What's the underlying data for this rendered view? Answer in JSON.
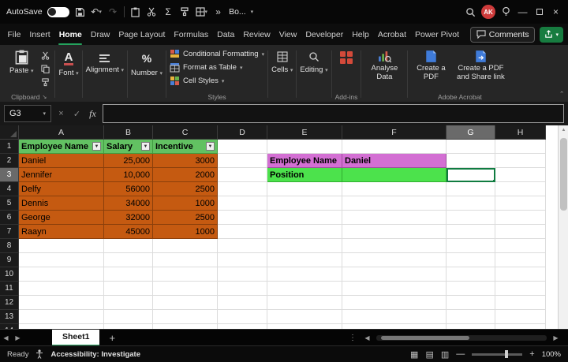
{
  "titlebar": {
    "autosave_label": "AutoSave",
    "workbook_label": "Bo...",
    "avatar_initials": "AK"
  },
  "ribbon": {
    "tabs": [
      "File",
      "Insert",
      "Home",
      "Draw",
      "Page Layout",
      "Formulas",
      "Data",
      "Review",
      "View",
      "Developer",
      "Help",
      "Acrobat",
      "Power Pivot"
    ],
    "active_tab": "Home",
    "comments_label": "Comments",
    "clipboard": {
      "group_label": "Clipboard",
      "paste_label": "Paste"
    },
    "font_label": "Font",
    "alignment_label": "Alignment",
    "number_label": "Number",
    "styles": {
      "group_label": "Styles",
      "conditional_formatting": "Conditional Formatting",
      "format_as_table": "Format as Table",
      "cell_styles": "Cell Styles"
    },
    "cells_label": "Cells",
    "editing_label": "Editing",
    "addins_group_label": "Add-ins",
    "analyse_data_label": "Analyse Data",
    "acrobat": {
      "group_label": "Adobe Acrobat",
      "create_pdf": "Create a PDF",
      "create_pdf_share": "Create a PDF and Share link"
    }
  },
  "formula_bar": {
    "name_box_value": "G3",
    "fx_label": "fx",
    "formula_value": ""
  },
  "grid": {
    "columns": [
      "A",
      "B",
      "C",
      "D",
      "E",
      "F",
      "G",
      "H"
    ],
    "visible_rows": 14,
    "selected_cell": "G3",
    "cells": [
      {
        "ref": "A1",
        "text": "Employee Name",
        "style": "thead",
        "filter": true
      },
      {
        "ref": "B1",
        "text": "Salary",
        "style": "thead",
        "filter": true
      },
      {
        "ref": "C1",
        "text": "Incentive",
        "style": "thead",
        "filter": true
      },
      {
        "ref": "A2",
        "text": "Daniel",
        "style": "orange"
      },
      {
        "ref": "B2",
        "text": "25,000",
        "style": "orange num"
      },
      {
        "ref": "C2",
        "text": "3000",
        "style": "orange num"
      },
      {
        "ref": "A3",
        "text": "Jennifer",
        "style": "orange"
      },
      {
        "ref": "B3",
        "text": "10,000",
        "style": "orange num"
      },
      {
        "ref": "C3",
        "text": "2000",
        "style": "orange num"
      },
      {
        "ref": "A4",
        "text": "Delfy",
        "style": "orange"
      },
      {
        "ref": "B4",
        "text": "56000",
        "style": "orange num"
      },
      {
        "ref": "C4",
        "text": "2500",
        "style": "orange num"
      },
      {
        "ref": "A5",
        "text": "Dennis",
        "style": "orange"
      },
      {
        "ref": "B5",
        "text": "34000",
        "style": "orange num"
      },
      {
        "ref": "C5",
        "text": "1000",
        "style": "orange num"
      },
      {
        "ref": "A6",
        "text": "George",
        "style": "orange"
      },
      {
        "ref": "B6",
        "text": "32000",
        "style": "orange num"
      },
      {
        "ref": "C6",
        "text": "2500",
        "style": "orange num"
      },
      {
        "ref": "A7",
        "text": "Raayn",
        "style": "orange"
      },
      {
        "ref": "B7",
        "text": "45000",
        "style": "orange num"
      },
      {
        "ref": "C7",
        "text": "1000",
        "style": "orange num"
      },
      {
        "ref": "E2",
        "text": "Employee Name",
        "style": "pink bold"
      },
      {
        "ref": "F2",
        "text": "Daniel",
        "style": "pink bold"
      },
      {
        "ref": "E3",
        "text": "Position",
        "style": "green bold"
      },
      {
        "ref": "F3",
        "text": "",
        "style": "green"
      }
    ]
  },
  "sheet_bar": {
    "tab": "Sheet1"
  },
  "status_bar": {
    "ready": "Ready",
    "accessibility": "Accessibility: Investigate",
    "zoom_value": "100%"
  },
  "icons": {
    "chevron_down": "▾",
    "overflow": "»",
    "undo": "↶",
    "redo": "↷",
    "sum": "Σ",
    "dots_vertical": "⋮",
    "arrow_left": "◀",
    "arrow_right": "▶",
    "arrow_up": "▲",
    "filter_arrow": "▼",
    "minimize": "—",
    "close": "×",
    "cancel": "×",
    "check": "✓",
    "view_normal": "▦",
    "view_layout": "▤",
    "view_break": "▥",
    "plus": "+",
    "minus": "—",
    "launcher": "↘",
    "collapse": "ˆ"
  },
  "colors": {
    "accent_green": "#24A35D",
    "selection_green": "#107C41",
    "table_header_green": "#62C162",
    "table_orange": "#C55A11",
    "lookup_pink": "#D36FD3",
    "lookup_green": "#4CE24C",
    "share_button_green": "#177C40",
    "avatar_red": "#CE3B3B",
    "addins_red": "#D44A3A"
  }
}
